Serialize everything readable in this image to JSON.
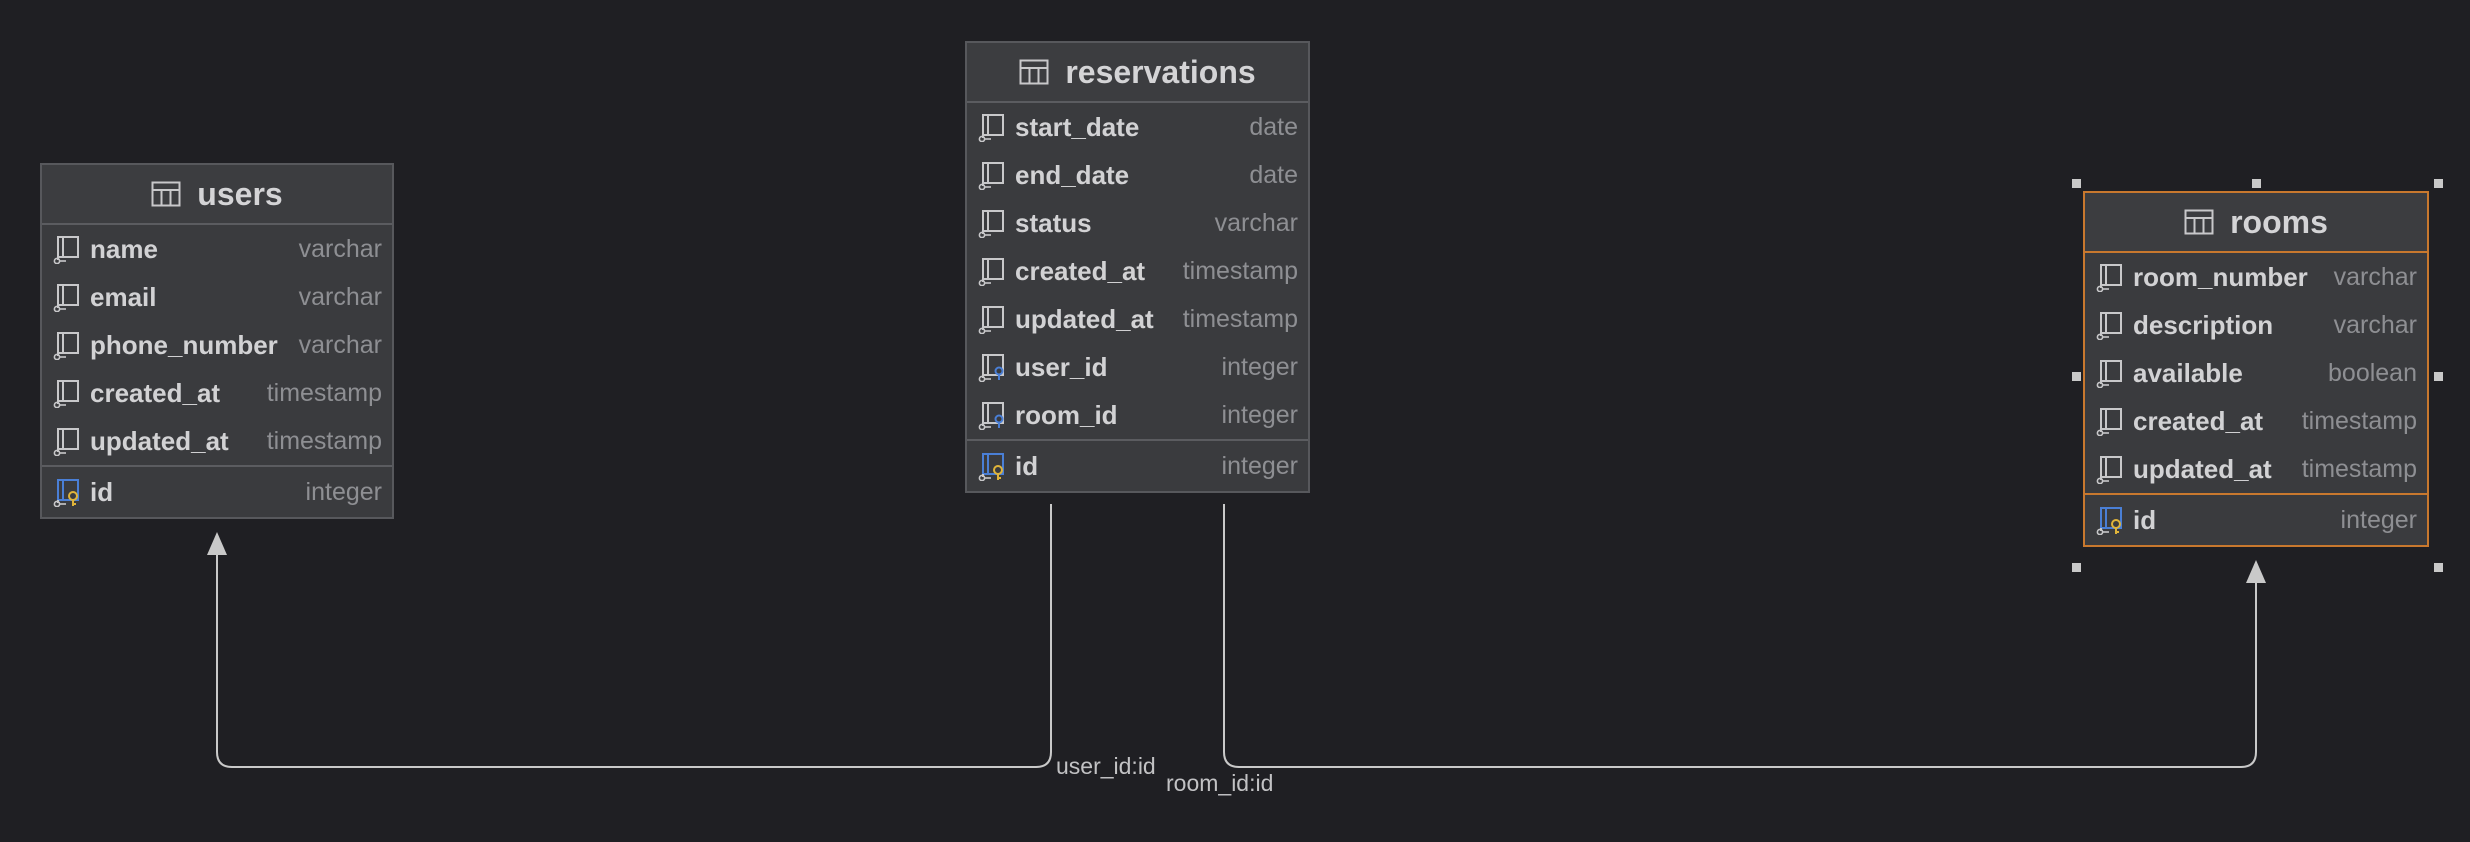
{
  "tables": {
    "users": {
      "name": "users",
      "columns": [
        {
          "name": "name",
          "type": "varchar"
        },
        {
          "name": "email",
          "type": "varchar"
        },
        {
          "name": "phone_number",
          "type": "varchar"
        },
        {
          "name": "created_at",
          "type": "timestamp"
        },
        {
          "name": "updated_at",
          "type": "timestamp"
        }
      ],
      "pk": {
        "name": "id",
        "type": "integer"
      }
    },
    "reservations": {
      "name": "reservations",
      "columns": [
        {
          "name": "start_date",
          "type": "date"
        },
        {
          "name": "end_date",
          "type": "date"
        },
        {
          "name": "status",
          "type": "varchar"
        },
        {
          "name": "created_at",
          "type": "timestamp"
        },
        {
          "name": "updated_at",
          "type": "timestamp"
        },
        {
          "name": "user_id",
          "type": "integer"
        },
        {
          "name": "room_id",
          "type": "integer"
        }
      ],
      "pk": {
        "name": "id",
        "type": "integer"
      }
    },
    "rooms": {
      "name": "rooms",
      "columns": [
        {
          "name": "room_number",
          "type": "varchar"
        },
        {
          "name": "description",
          "type": "varchar"
        },
        {
          "name": "available",
          "type": "boolean"
        },
        {
          "name": "created_at",
          "type": "timestamp"
        },
        {
          "name": "updated_at",
          "type": "timestamp"
        }
      ],
      "pk": {
        "name": "id",
        "type": "integer"
      }
    }
  },
  "relations": {
    "user": "user_id:id",
    "room": "room_id:id"
  },
  "colors": {
    "background": "#1f1f23",
    "selection": "#c8782e",
    "fk_icon": "#4a7fd6",
    "pk_icon": "#e0b43a"
  }
}
